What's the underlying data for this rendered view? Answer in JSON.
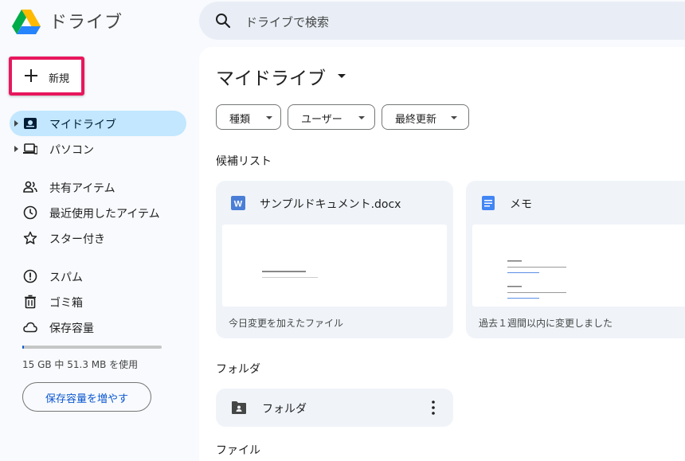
{
  "app": {
    "title": "ドライブ",
    "logo_icon": "google-drive-logo"
  },
  "search": {
    "placeholder": "ドライブで検索",
    "icon": "search-icon"
  },
  "new_button": {
    "label": "新規",
    "icon": "plus-icon",
    "highlight_color": "#e8175d"
  },
  "sidebar": {
    "items": [
      {
        "label": "マイドライブ",
        "icon": "my-drive-icon",
        "active": true,
        "expandable": true
      },
      {
        "label": "パソコン",
        "icon": "computers-icon",
        "active": false,
        "expandable": true
      },
      {
        "label": "共有アイテム",
        "icon": "shared-icon",
        "active": false
      },
      {
        "label": "最近使用したアイテム",
        "icon": "clock-icon",
        "active": false
      },
      {
        "label": "スター付き",
        "icon": "star-icon",
        "active": false
      },
      {
        "label": "スパム",
        "icon": "spam-icon",
        "active": false
      },
      {
        "label": "ゴミ箱",
        "icon": "trash-icon",
        "active": false
      },
      {
        "label": "保存容量",
        "icon": "cloud-icon",
        "active": false
      }
    ]
  },
  "storage": {
    "usage_text": "15 GB 中 51.3 MB を使用",
    "used_fraction": 0.0033,
    "button_label": "保存容量を増やす"
  },
  "main": {
    "title": "マイドライブ",
    "filters": [
      {
        "label": "種類"
      },
      {
        "label": "ユーザー"
      },
      {
        "label": "最終更新"
      }
    ],
    "suggested_title": "候補リスト",
    "suggested": [
      {
        "title": "サンプルドキュメント.docx",
        "icon": "word-doc-icon",
        "icon_color": "#4285f4",
        "subtitle": "今日変更を加えたファイル"
      },
      {
        "title": "メモ",
        "icon": "google-docs-icon",
        "icon_color": "#4285f4",
        "subtitle": "過去１週間以内に変更しました"
      }
    ],
    "folders_title": "フォルダ",
    "folders": [
      {
        "label": "フォルダ",
        "icon": "shared-folder-icon"
      }
    ],
    "files_title": "ファイル"
  },
  "colors": {
    "accent": "#0b57d0",
    "active_nav_bg": "#c2e7ff",
    "page_bg": "#f8fafd",
    "card_bg": "#f0f4f9"
  }
}
